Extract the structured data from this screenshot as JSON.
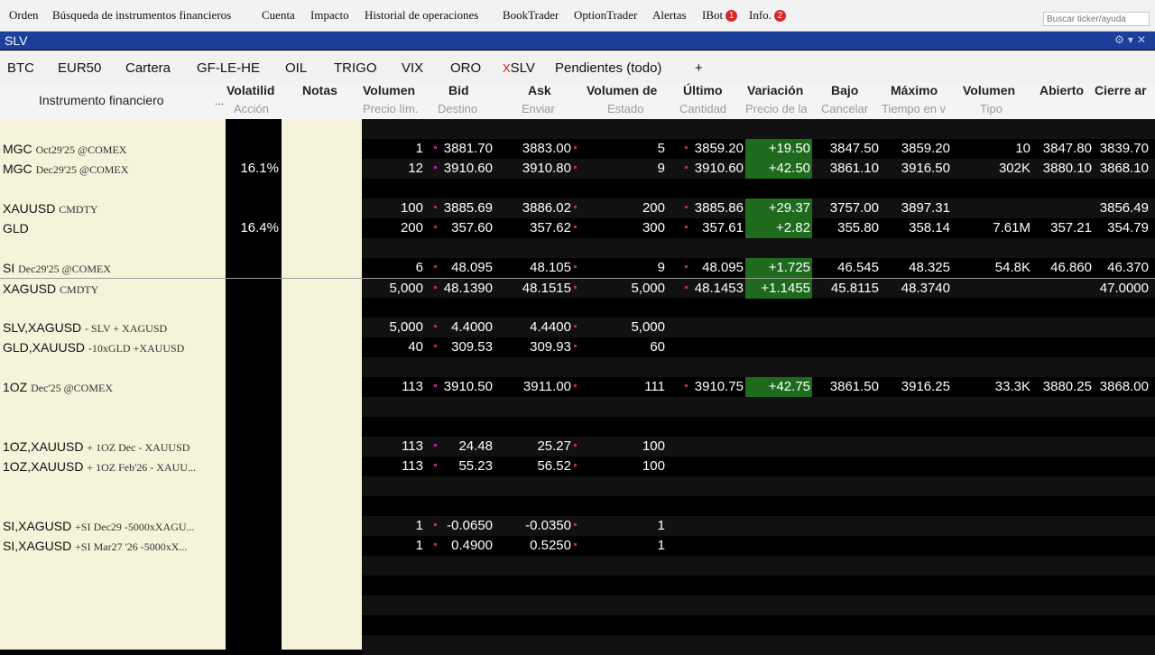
{
  "menu": {
    "orden": "Orden",
    "busqueda": "Búsqueda de instrumentos financieros",
    "cuenta": "Cuenta",
    "impacto": "Impacto",
    "historial": "Historial de operaciones",
    "booktrader": "BookTrader",
    "optiontrader": "OptionTrader",
    "alertas": "Alertas",
    "ibot": "IBot",
    "ibot_badge": "1",
    "info": "Info.",
    "info_badge": "2",
    "search_placeholder": "Buscar ticker/ayuda"
  },
  "window": {
    "title": "SLV"
  },
  "tabs": [
    {
      "label": "BTC"
    },
    {
      "label": "EUR50"
    },
    {
      "label": "Cartera"
    },
    {
      "label": "GF-LE-HE"
    },
    {
      "label": "OIL"
    },
    {
      "label": "TRIGO"
    },
    {
      "label": "VIX"
    },
    {
      "label": "ORO"
    },
    {
      "label": "SLV",
      "close": "X"
    },
    {
      "label": "Pendientes (todo)"
    },
    {
      "label": "+"
    }
  ],
  "columns": {
    "instrumento": "Instrumento financiero",
    "instrumento_more": "...",
    "volatilidad": "Volatilid",
    "accion": "Acción",
    "notas": "Notas",
    "volumen": "Volumen",
    "precio_lim": "Precio lím.",
    "bid": "Bid",
    "destino": "Destino",
    "ask": "Ask",
    "enviar": "Enviar",
    "volumen_de": "Volumen de",
    "estado": "Estado",
    "ultimo": "Último",
    "cantidad": "Cantidad",
    "variacion": "Variación",
    "precio_de": "Precio de la",
    "bajo": "Bajo",
    "cancelar": "Cancelar",
    "maximo": "Máximo",
    "tiempo": "Tiempo en v",
    "volumen2": "Volumen",
    "tipo": "Tipo",
    "abierto": "Abierto",
    "cierre": "Cierre ar"
  },
  "rows": [
    {
      "sym": "MGC",
      "desc": "Oct29'25 @COMEX",
      "vol": "",
      "bsize": "1",
      "bid": "3881.70",
      "ask": "3883.00",
      "asize": "5",
      "last": "3859.20",
      "chg": "+19.50",
      "low": "3847.50",
      "high": "3859.20",
      "volume": "10",
      "open": "3847.80",
      "close": "3839.70"
    },
    {
      "sym": "MGC",
      "desc": "Dec29'25 @COMEX",
      "vol": "16.1%",
      "bsize": "12",
      "bid": "3910.60",
      "ask": "3910.80",
      "asize": "9",
      "last": "3910.60",
      "chg": "+42.50",
      "low": "3861.10",
      "high": "3916.50",
      "volume": "302K",
      "open": "3880.10",
      "close": "3868.10"
    },
    {
      "sym": "XAUUSD",
      "desc": "CMDTY",
      "vol": "",
      "bsize": "100",
      "bid": "3885.69",
      "ask": "3886.02",
      "asize": "200",
      "last": "3885.86",
      "chg": "+29.37",
      "low": "3757.00",
      "high": "3897.31",
      "volume": "",
      "open": "",
      "close": "3856.49"
    },
    {
      "sym": "GLD",
      "desc": "",
      "vol": "16.4%",
      "bsize": "200",
      "bid": "357.60",
      "ask": "357.62",
      "asize": "300",
      "last": "357.61",
      "chg": "+2.82",
      "low": "355.80",
      "high": "358.14",
      "volume": "7.61M",
      "open": "357.21",
      "close": "354.79"
    },
    {
      "sym": "SI",
      "desc": "Dec29'25 @COMEX",
      "vol": "",
      "bsize": "6",
      "bid": "48.095",
      "ask": "48.105",
      "asize": "9",
      "last": "48.095",
      "chg": "+1.725",
      "low": "46.545",
      "high": "48.325",
      "volume": "54.8K",
      "open": "46.860",
      "close": "46.370"
    },
    {
      "sym": "XAGUSD",
      "desc": "CMDTY",
      "vol": "",
      "bsize": "5,000",
      "bid": "48.1390",
      "ask": "48.1515",
      "asize": "5,000",
      "last": "48.1453",
      "chg": "+1.1455",
      "low": "45.8115",
      "high": "48.3740",
      "volume": "",
      "open": "",
      "close": "47.0000"
    },
    {
      "sym": "SLV,XAGUSD",
      "desc": "- SLV + XAGUSD",
      "vol": "",
      "bsize": "5,000",
      "bid": "4.4000",
      "ask": "4.4400",
      "asize": "5,000",
      "last": "",
      "chg": "",
      "low": "",
      "high": "",
      "volume": "",
      "open": "",
      "close": ""
    },
    {
      "sym": "GLD,XAUUSD",
      "desc": "-10xGLD +XAUUSD",
      "vol": "",
      "bsize": "40",
      "bid": "309.53",
      "ask": "309.93",
      "asize": "60",
      "last": "",
      "chg": "",
      "low": "",
      "high": "",
      "volume": "",
      "open": "",
      "close": ""
    },
    {
      "sym": "1OZ",
      "desc": "Dec'25 @COMEX",
      "vol": "",
      "bsize": "113",
      "bid": "3910.50",
      "ask": "3911.00",
      "asize": "111",
      "last": "3910.75",
      "chg": "+42.75",
      "low": "3861.50",
      "high": "3916.25",
      "volume": "33.3K",
      "open": "3880.25",
      "close": "3868.00"
    },
    {
      "sym": "1OZ,XAUUSD",
      "desc": "+ 1OZ Dec - XAUUSD",
      "vol": "",
      "bsize": "113",
      "bid": "24.48",
      "ask": "25.27",
      "asize": "100",
      "last": "",
      "chg": "",
      "low": "",
      "high": "",
      "volume": "",
      "open": "",
      "close": ""
    },
    {
      "sym": "1OZ,XAUUSD",
      "desc": "+ 1OZ Feb'26 - XAUU...",
      "vol": "",
      "bsize": "113",
      "bid": "55.23",
      "ask": "56.52",
      "asize": "100",
      "last": "",
      "chg": "",
      "low": "",
      "high": "",
      "volume": "",
      "open": "",
      "close": ""
    },
    {
      "sym": "SI,XAGUSD",
      "desc": "+SI Dec29 -5000xXAGU...",
      "vol": "",
      "bsize": "1",
      "bid": "-0.0650",
      "ask": "-0.0350",
      "asize": "1",
      "last": "",
      "chg": "",
      "low": "",
      "high": "",
      "volume": "",
      "open": "",
      "close": ""
    },
    {
      "sym": "SI,XAGUSD",
      "desc": "+SI Mar27 '26 -5000xX...",
      "vol": "",
      "bsize": "1",
      "bid": "0.4900",
      "ask": "0.5250",
      "asize": "1",
      "last": "",
      "chg": "",
      "low": "",
      "high": "",
      "volume": "",
      "open": "",
      "close": ""
    }
  ],
  "colors": {
    "accent": "#1c3f9c",
    "positive": "#1e6b1e",
    "instrument_bg": "#f5f3d9"
  }
}
